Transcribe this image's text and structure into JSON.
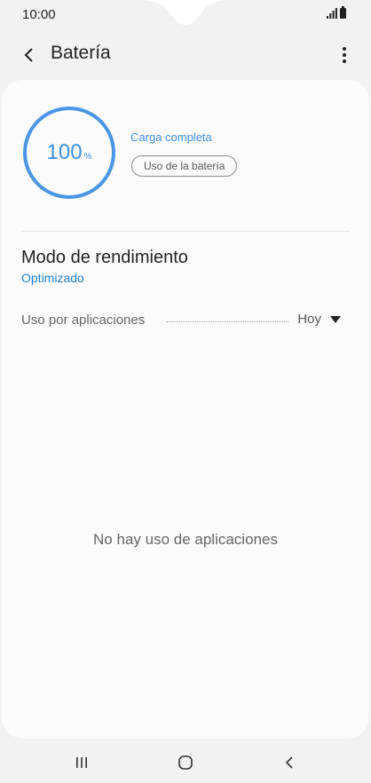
{
  "status_bar": {
    "time": "10:00",
    "icons": [
      "signal-icon",
      "battery-icon"
    ]
  },
  "app_bar": {
    "title": "Batería",
    "back_icon": "chevron-left-icon",
    "more_icon": "more-vert-icon"
  },
  "battery": {
    "percent_value": "100",
    "percent_unit": "%",
    "level_fraction": 1.0,
    "status": "Carga completa",
    "usage_button": "Uso de la batería",
    "ring_color": "#4a95e6"
  },
  "performance_mode": {
    "title": "Modo de rendimiento",
    "value": "Optimizado"
  },
  "app_usage": {
    "label": "Uso por aplicaciones",
    "period": "Hoy",
    "empty_message": "No hay uso de aplicaciones"
  },
  "nav_bar": {
    "icons": [
      "recents-icon",
      "home-icon",
      "back-icon"
    ]
  }
}
